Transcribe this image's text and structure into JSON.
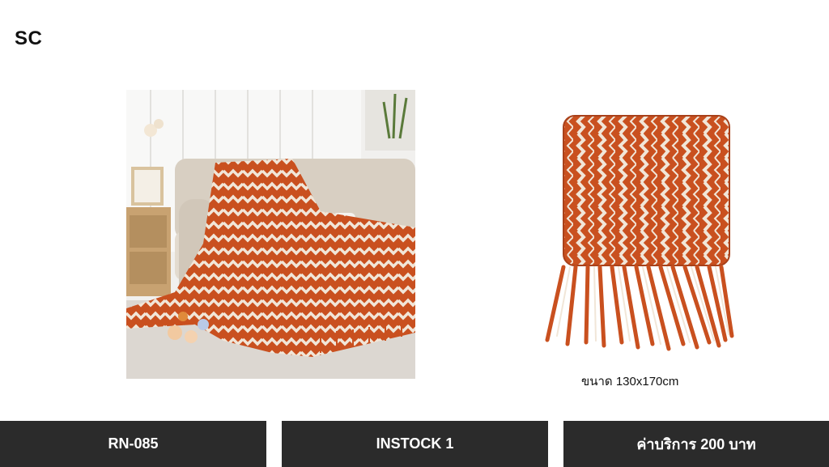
{
  "brand": {
    "logo_text": "SC"
  },
  "product": {
    "size_label": "ขนาด 130x170cm",
    "colors": {
      "primary": "#c9501f",
      "pattern": "#f1e6d8"
    }
  },
  "footer": {
    "code": "RN-085",
    "stock": "INSTOCK 1",
    "price": "ค่าบริการ 200  บาท"
  }
}
